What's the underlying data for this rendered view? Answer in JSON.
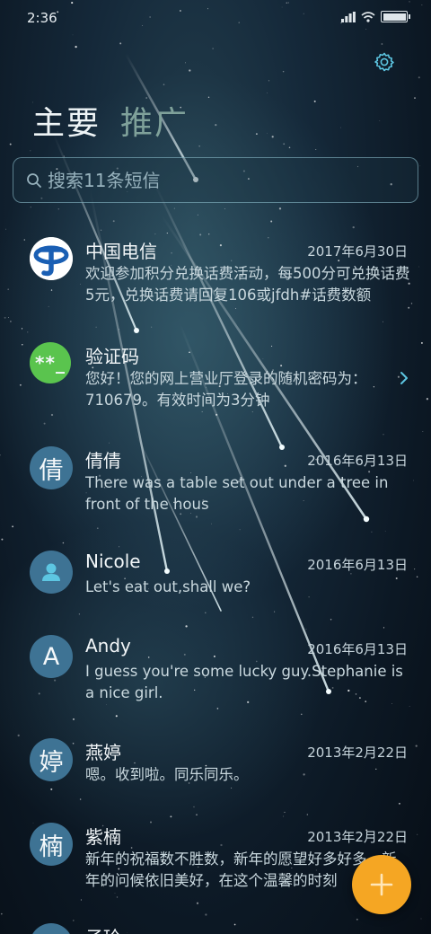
{
  "status_bar": {
    "time": "2:36"
  },
  "tabs": [
    {
      "label": "主要",
      "active": true
    },
    {
      "label": "推广",
      "active": false
    }
  ],
  "search": {
    "placeholder": "搜索11条短信"
  },
  "messages": [
    {
      "sender": "中国电信",
      "date": "2017年6月30日",
      "preview": "欢迎参加积分兑换话费活动，每500分可兑换话费5元，兑换话费请回复106或jfdh#话费数额",
      "avatar_icon": "china-telecom-logo"
    },
    {
      "sender": "验证码",
      "date": "",
      "preview": "您好！您的网上营业厅登录的随机密码为：710679。有效时间为3分钟",
      "avatar_text": "**_",
      "avatar_color": "#5ac44e"
    },
    {
      "sender": "倩倩",
      "date": "2016年6月13日",
      "preview": "There was a table set out under a tree in front of the hous",
      "avatar_text": "倩"
    },
    {
      "sender": "Nicole",
      "date": "2016年6月13日",
      "preview": "Let's eat out,shall we?",
      "avatar_icon": "person-icon"
    },
    {
      "sender": "Andy",
      "date": "2016年6月13日",
      "preview": "I guess you're some lucky guy.Stephanie is a nice girl.",
      "avatar_text": "A"
    },
    {
      "sender": "燕婷",
      "date": "2013年2月22日",
      "preview": "嗯。收到啦。同乐同乐。",
      "avatar_text": "婷"
    },
    {
      "sender": "紫楠",
      "date": "2013年2月22日",
      "preview": "新年的祝福数不胜数，新年的愿望好多好多，新年的问候依旧美好，在这个温馨的时刻",
      "avatar_text": "楠"
    },
    {
      "sender": "子玲",
      "date": "",
      "preview": "",
      "avatar_text": "玲"
    }
  ],
  "colors": {
    "accent": "#f5a623",
    "avatar_blue": "#3e7394",
    "tab_inactive": "#7fa19a"
  }
}
